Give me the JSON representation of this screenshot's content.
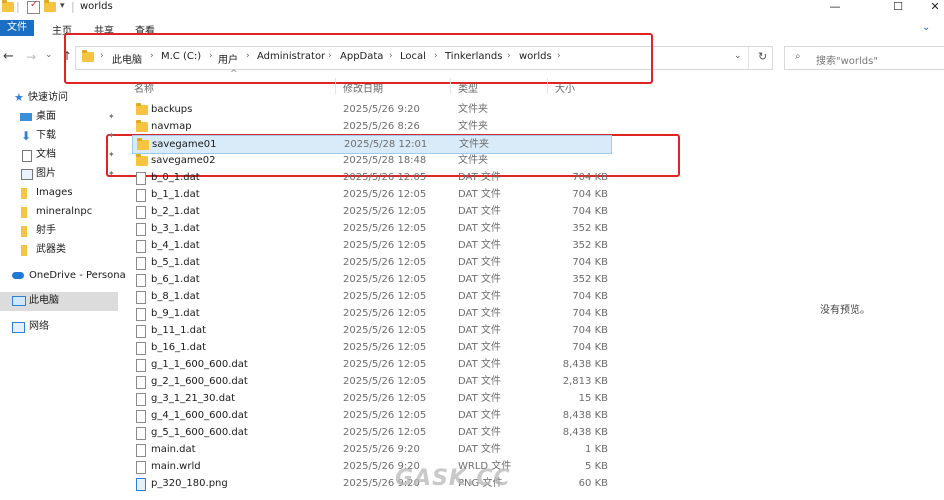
{
  "window": {
    "title": "worlds",
    "minimize": "—",
    "maximize": "☐",
    "close": "✕"
  },
  "ribbon": {
    "tabs": [
      "文件",
      "主页",
      "共享",
      "查看"
    ]
  },
  "address": {
    "path": [
      "此电脑",
      "M.C (C:)",
      "用户",
      "Administrator",
      "AppData",
      "Local",
      "Tinkerlands",
      "worlds"
    ],
    "search_placeholder": "搜索\"worlds\""
  },
  "nav": {
    "items": [
      {
        "label": "快速访问",
        "icon": "star-icon"
      },
      {
        "label": "桌面",
        "icon": "desktop-icon"
      },
      {
        "label": "下载",
        "icon": "download-icon"
      },
      {
        "label": "文档",
        "icon": "document-icon"
      },
      {
        "label": "图片",
        "icon": "picture-icon"
      },
      {
        "label": "Images",
        "icon": "folder-icon"
      },
      {
        "label": "mineralnpc",
        "icon": "folder-icon"
      },
      {
        "label": "射手",
        "icon": "folder-icon"
      },
      {
        "label": "武器类",
        "icon": "folder-icon"
      },
      {
        "label": "OneDrive - Persona",
        "icon": "cloud-icon"
      },
      {
        "label": "此电脑",
        "icon": "computer-icon"
      },
      {
        "label": "网络",
        "icon": "network-icon"
      }
    ]
  },
  "columns": {
    "name": "名称",
    "date": "修改日期",
    "type": "类型",
    "size": "大小"
  },
  "files": [
    {
      "name": "backups",
      "date": "2025/5/26 9:20",
      "type": "文件夹",
      "size": "",
      "kind": "folder"
    },
    {
      "name": "navmap",
      "date": "2025/5/26 8:26",
      "type": "文件夹",
      "size": "",
      "kind": "folder"
    },
    {
      "name": "savegame01",
      "date": "2025/5/28 12:01",
      "type": "文件夹",
      "size": "",
      "kind": "folder"
    },
    {
      "name": "savegame02",
      "date": "2025/5/28 18:48",
      "type": "文件夹",
      "size": "",
      "kind": "folder"
    },
    {
      "name": "b_0_1.dat",
      "date": "2025/5/26 12:05",
      "type": "DAT 文件",
      "size": "704 KB",
      "kind": "file"
    },
    {
      "name": "b_1_1.dat",
      "date": "2025/5/26 12:05",
      "type": "DAT 文件",
      "size": "704 KB",
      "kind": "file"
    },
    {
      "name": "b_2_1.dat",
      "date": "2025/5/26 12:05",
      "type": "DAT 文件",
      "size": "704 KB",
      "kind": "file"
    },
    {
      "name": "b_3_1.dat",
      "date": "2025/5/26 12:05",
      "type": "DAT 文件",
      "size": "352 KB",
      "kind": "file"
    },
    {
      "name": "b_4_1.dat",
      "date": "2025/5/26 12:05",
      "type": "DAT 文件",
      "size": "352 KB",
      "kind": "file"
    },
    {
      "name": "b_5_1.dat",
      "date": "2025/5/26 12:05",
      "type": "DAT 文件",
      "size": "704 KB",
      "kind": "file"
    },
    {
      "name": "b_6_1.dat",
      "date": "2025/5/26 12:05",
      "type": "DAT 文件",
      "size": "352 KB",
      "kind": "file"
    },
    {
      "name": "b_8_1.dat",
      "date": "2025/5/26 12:05",
      "type": "DAT 文件",
      "size": "704 KB",
      "kind": "file"
    },
    {
      "name": "b_9_1.dat",
      "date": "2025/5/26 12:05",
      "type": "DAT 文件",
      "size": "704 KB",
      "kind": "file"
    },
    {
      "name": "b_11_1.dat",
      "date": "2025/5/26 12:05",
      "type": "DAT 文件",
      "size": "704 KB",
      "kind": "file"
    },
    {
      "name": "b_16_1.dat",
      "date": "2025/5/26 12:05",
      "type": "DAT 文件",
      "size": "704 KB",
      "kind": "file"
    },
    {
      "name": "g_1_1_600_600.dat",
      "date": "2025/5/26 12:05",
      "type": "DAT 文件",
      "size": "8,438 KB",
      "kind": "file"
    },
    {
      "name": "g_2_1_600_600.dat",
      "date": "2025/5/26 12:05",
      "type": "DAT 文件",
      "size": "2,813 KB",
      "kind": "file"
    },
    {
      "name": "g_3_1_21_30.dat",
      "date": "2025/5/26 12:05",
      "type": "DAT 文件",
      "size": "15 KB",
      "kind": "file"
    },
    {
      "name": "g_4_1_600_600.dat",
      "date": "2025/5/26 12:05",
      "type": "DAT 文件",
      "size": "8,438 KB",
      "kind": "file"
    },
    {
      "name": "g_5_1_600_600.dat",
      "date": "2025/5/26 12:05",
      "type": "DAT 文件",
      "size": "8,438 KB",
      "kind": "file"
    },
    {
      "name": "main.dat",
      "date": "2025/5/26 9:20",
      "type": "DAT 文件",
      "size": "1 KB",
      "kind": "file"
    },
    {
      "name": "main.wrld",
      "date": "2025/5/26 9:20",
      "type": "WRLD 文件",
      "size": "5 KB",
      "kind": "file"
    },
    {
      "name": "p_320_180.png",
      "date": "2025/5/26 9:20",
      "type": "PNG 文件",
      "size": "60 KB",
      "kind": "image"
    }
  ],
  "preview": {
    "empty_text": "没有预览。"
  },
  "watermark": "GASK.CC"
}
